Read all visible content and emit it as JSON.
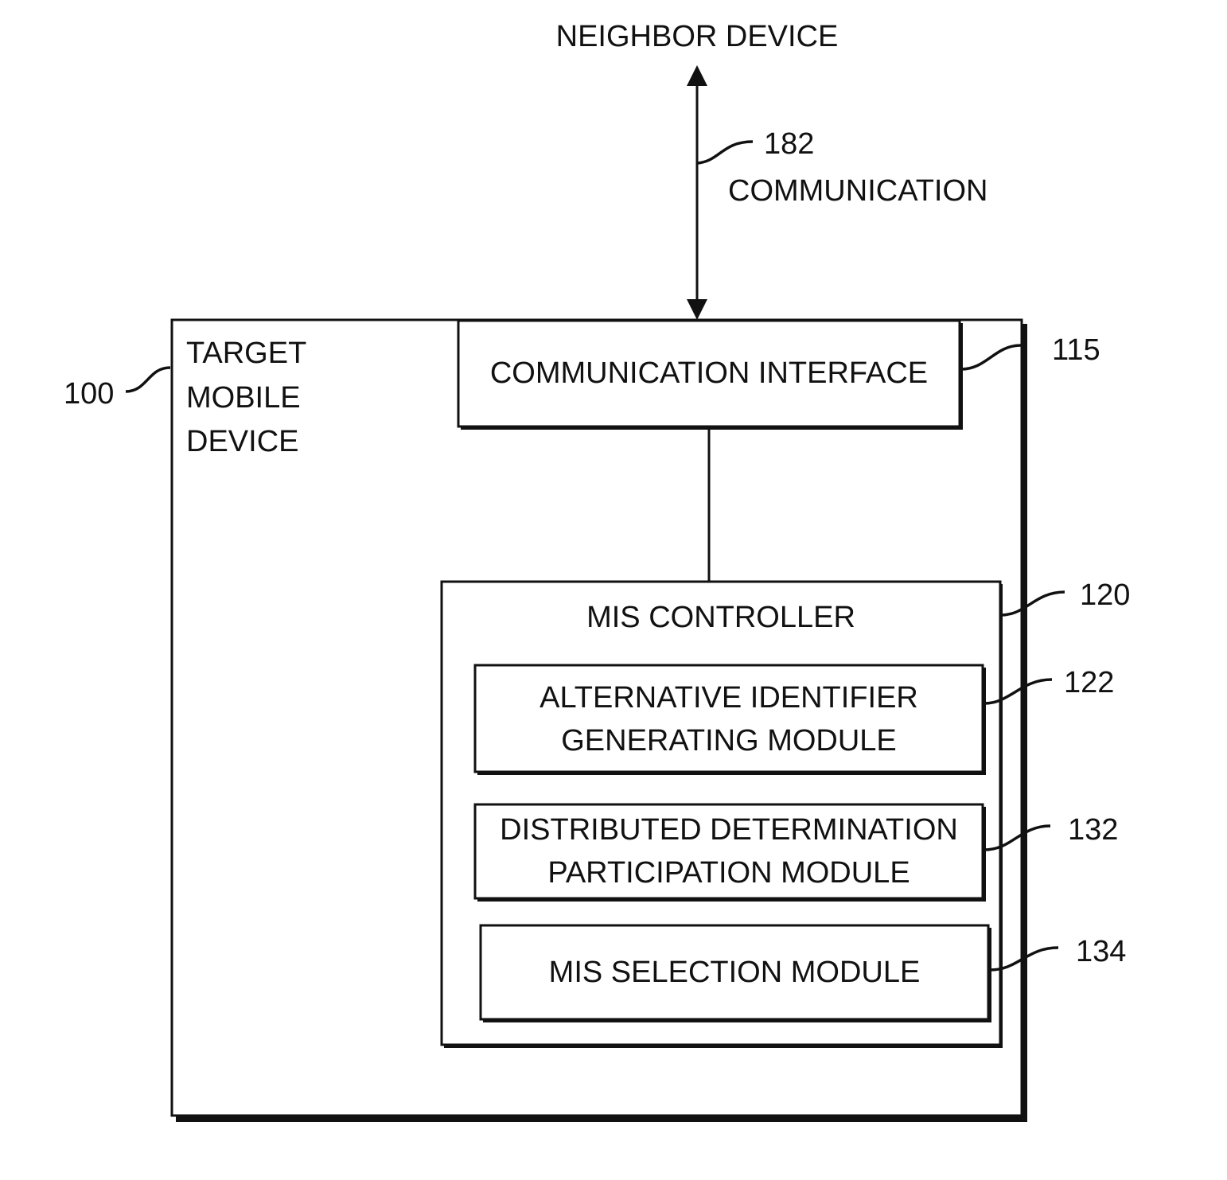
{
  "neighbor_device": {
    "label": "NEIGHBOR DEVICE"
  },
  "communication_link": {
    "ref": "182",
    "label": "COMMUNICATION"
  },
  "target_device": {
    "ref": "100",
    "label_lines": [
      "TARGET",
      "MOBILE",
      "DEVICE"
    ]
  },
  "communication_interface": {
    "ref": "115",
    "label": "COMMUNICATION INTERFACE"
  },
  "mis_controller": {
    "ref": "120",
    "label": "MIS CONTROLLER"
  },
  "modules": [
    {
      "ref": "122",
      "label_lines": [
        "ALTERNATIVE IDENTIFIER",
        "GENERATING MODULE"
      ]
    },
    {
      "ref": "132",
      "label_lines": [
        "DISTRIBUTED DETERMINATION",
        "PARTICIPATION MODULE"
      ]
    },
    {
      "ref": "134",
      "label_lines": [
        "MIS SELECTION MODULE"
      ]
    }
  ],
  "colors": {
    "ink": "#111111",
    "background": "#ffffff"
  }
}
